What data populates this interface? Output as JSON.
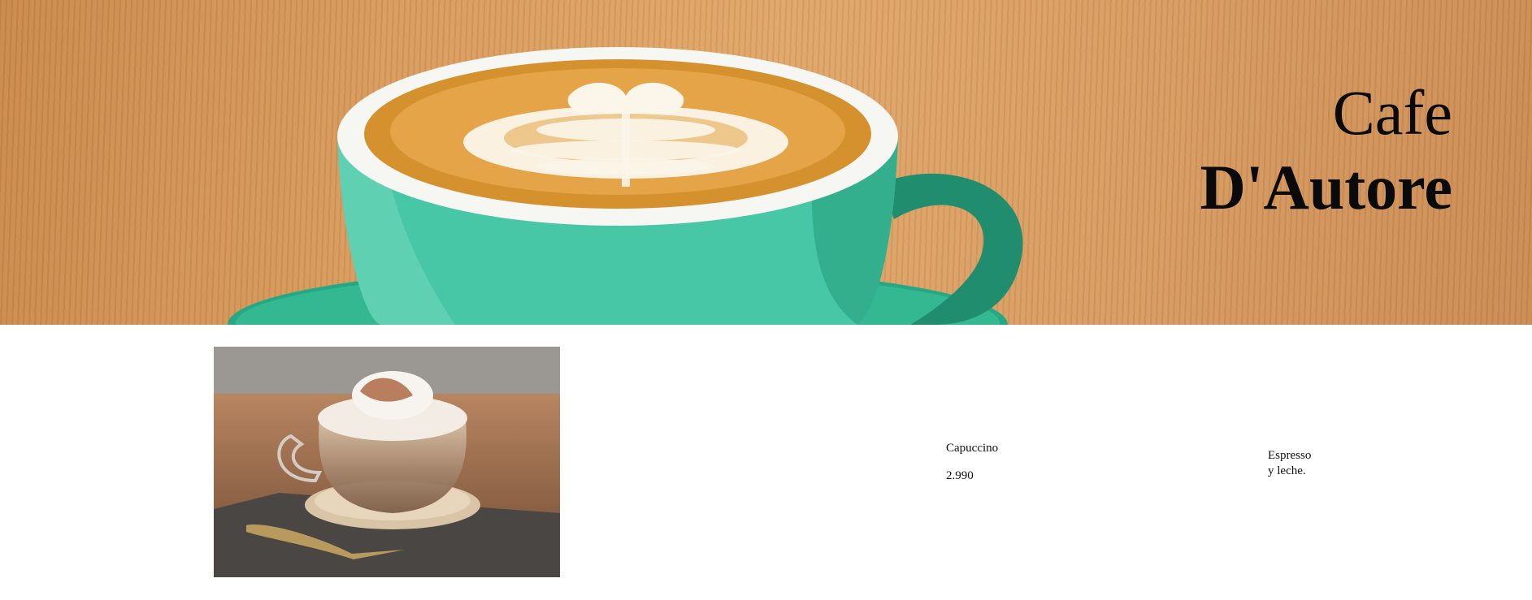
{
  "hero": {
    "title_line1": "Cafe",
    "title_line2": "D'Autore",
    "image": "latte-art-in-teal-cup"
  },
  "product": {
    "image": "capuccino-glass-mug-photo",
    "name": "Capuccino",
    "price": "2.990",
    "description_line1": "Espresso",
    "description_line2": "y leche."
  },
  "colors": {
    "wood": "#d89a5c",
    "cup": "#3fbf9f",
    "foam": "#f4ead9",
    "crema": "#d9922e"
  }
}
